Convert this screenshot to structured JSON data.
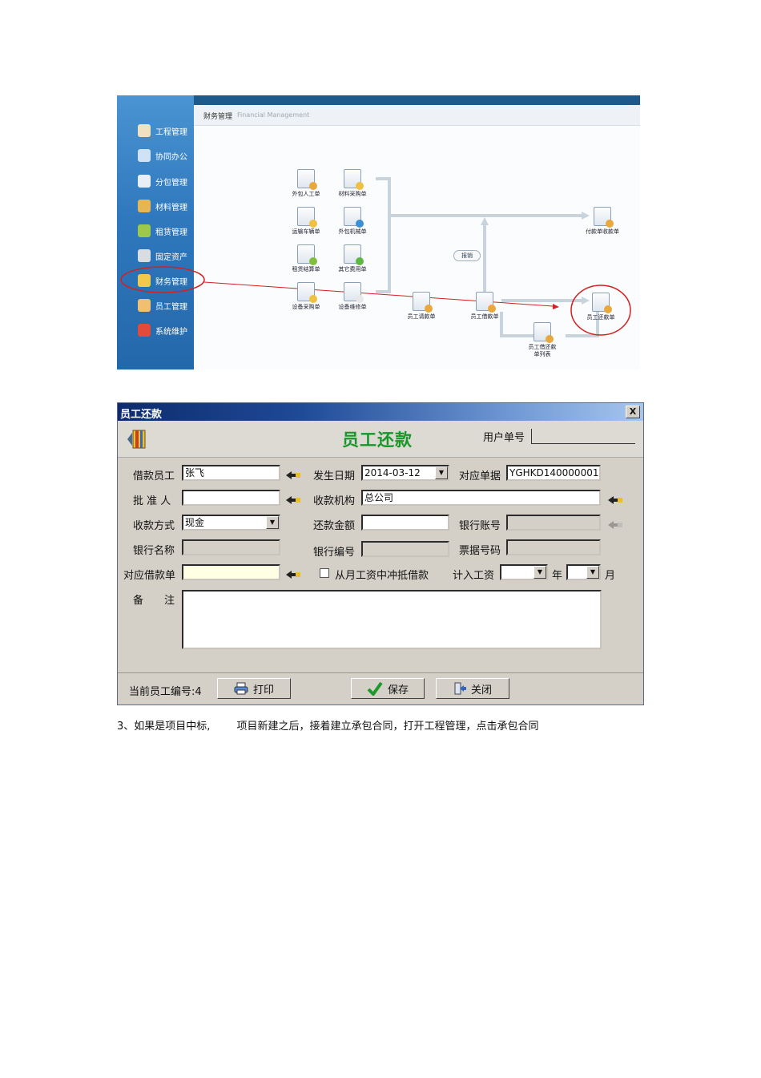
{
  "finance_module": {
    "panel_title": "财务管理",
    "panel_title_en": "Financial Management",
    "sidebar": [
      {
        "label": "工程管理",
        "icon": "engineering-icon"
      },
      {
        "label": "协同办公",
        "icon": "office-icon"
      },
      {
        "label": "分包管理",
        "icon": "subcontract-icon"
      },
      {
        "label": "材料管理",
        "icon": "material-icon"
      },
      {
        "label": "租赁管理",
        "icon": "lease-icon"
      },
      {
        "label": "固定资产",
        "icon": "fixed-asset-icon"
      },
      {
        "label": "财务管理",
        "icon": "finance-icon"
      },
      {
        "label": "员工管理",
        "icon": "staff-icon"
      },
      {
        "label": "系统维护",
        "icon": "system-icon"
      }
    ],
    "flow_nodes": [
      {
        "label": "外包人工单"
      },
      {
        "label": "材料采购单"
      },
      {
        "label": "运输车辆单"
      },
      {
        "label": "外包机械单"
      },
      {
        "label": "租赁结算单"
      },
      {
        "label": "其它费用单"
      },
      {
        "label": "设备采购单"
      },
      {
        "label": "设备维修单"
      },
      {
        "label": "员工请款单"
      },
      {
        "label": "员工借款单"
      },
      {
        "label": "付款单收款单"
      },
      {
        "label": "员工还款单"
      },
      {
        "label": "员工借还款",
        "label2": "单列表"
      }
    ],
    "cancel_tag": "报销",
    "accent_color": "#d42020"
  },
  "dialog": {
    "title": "员工还款",
    "close_label": "X",
    "heading": "员工还款",
    "user_no_label": "用户单号",
    "labels": {
      "borrower": "借款员工",
      "date": "发生日期",
      "ref_doc": "对应单据",
      "approver": "批 准 人",
      "org": "收款机构",
      "method": "收款方式",
      "amount": "还款金额",
      "bank_account": "银行账号",
      "bank_name": "银行名称",
      "bank_no": "银行编号",
      "bill_no": "票据号码",
      "loan_doc": "对应借款单",
      "deduct": "从月工资中冲抵借款",
      "salary": "计入工资",
      "year": "年",
      "month": "月",
      "remarks_1": "备",
      "remarks_2": "注"
    },
    "values": {
      "borrower": "张飞",
      "date": "2014-03-12",
      "ref_doc": "YGHKD140000001",
      "approver": "",
      "org": "总公司",
      "method": "现金",
      "amount": "",
      "bank_account": "",
      "bank_name": "",
      "bank_no": "",
      "bill_no": "",
      "loan_doc": "",
      "year": "",
      "month": ""
    },
    "footer": {
      "current_staff": "当前员工编号:4",
      "print": "打印",
      "save": "保存",
      "close": "关闭"
    }
  },
  "caption": "3、如果是项目中标,        项目新建之后，接着建立承包合同，打开工程管理，点击承包合同"
}
